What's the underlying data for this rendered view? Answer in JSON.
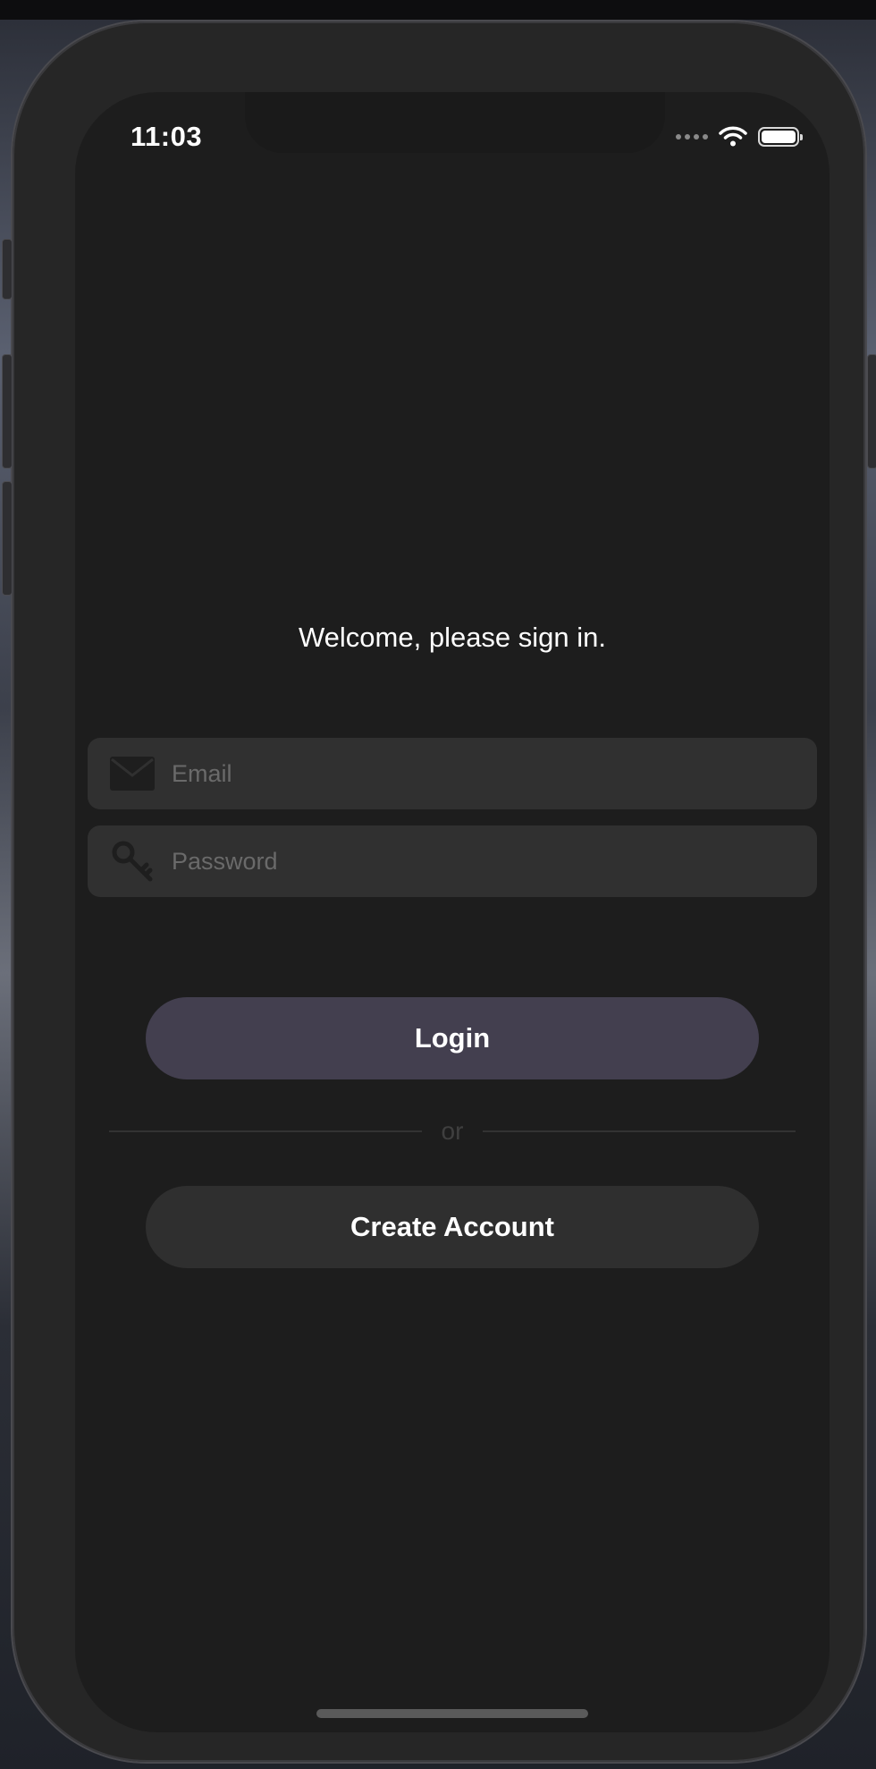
{
  "status_bar": {
    "time": "11:03",
    "icons": [
      "cellular-signal-icon",
      "wifi-icon",
      "battery-icon"
    ]
  },
  "login": {
    "welcome_text": "Welcome, please sign in.",
    "email": {
      "placeholder": "Email",
      "value": "",
      "icon": "envelope-icon"
    },
    "password": {
      "placeholder": "Password",
      "value": "",
      "icon": "key-icon"
    },
    "login_label": "Login",
    "divider_label": "or",
    "create_account_label": "Create Account"
  },
  "colors": {
    "screen_background": "#1d1d1d",
    "field_background": "#303030",
    "login_button": "#433f4f",
    "create_account_button": "#2f2f2f",
    "text": "#ffffff"
  }
}
